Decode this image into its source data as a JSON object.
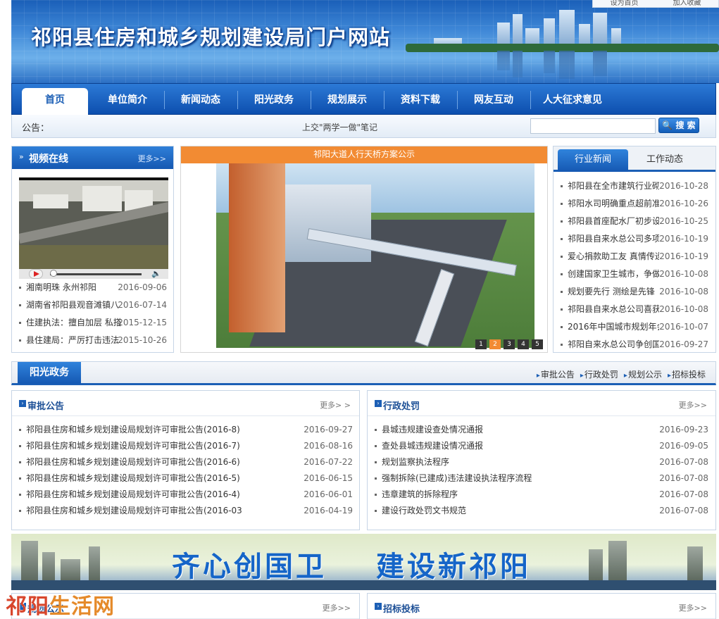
{
  "header": {
    "site_title": "祁阳县住房和城乡规划建设局门户网站",
    "top_links": [
      "设为首页",
      "加入收藏"
    ]
  },
  "nav": {
    "items": [
      {
        "label": "首页"
      },
      {
        "label": "单位简介"
      },
      {
        "label": "新闻动态"
      },
      {
        "label": "阳光政务"
      },
      {
        "label": "规划展示"
      },
      {
        "label": "资料下载"
      },
      {
        "label": "网友互动"
      },
      {
        "label": "人大征求意见"
      }
    ]
  },
  "notice": {
    "label": "公告：",
    "text": "上交\"两学一做\"笔记",
    "search_value": "",
    "search_button": "搜 索"
  },
  "video": {
    "title": "视频在线",
    "more": "更多>>",
    "items": [
      {
        "title": "湘南明珠 永州祁阳",
        "date": "2016-09-06"
      },
      {
        "title": "湖南省祁阳县观音滩镇八",
        "date": "2016-07-14"
      },
      {
        "title": "住建执法：擅自加层 私搭",
        "date": "2015-12-15"
      },
      {
        "title": "县住建局：严厉打击违法",
        "date": "2015-10-26"
      }
    ]
  },
  "slideshow": {
    "caption": "祁阳大道人行天桥方案公示",
    "pages": [
      "1",
      "2",
      "3",
      "4",
      "5"
    ],
    "active_page": 2
  },
  "news_tabs": {
    "tabs": [
      "行业新闻",
      "工作动态"
    ],
    "items": [
      {
        "title": "祁阳县在全市建筑行业砌",
        "date": "2016-10-28"
      },
      {
        "title": "祁阳水司明确重点超前准",
        "date": "2016-10-26"
      },
      {
        "title": "祁阳县首座配水厂初步设",
        "date": "2016-10-25"
      },
      {
        "title": "祁阳县自来水总公司多项",
        "date": "2016-10-19"
      },
      {
        "title": "爱心捐款助工友 真情传递",
        "date": "2016-10-19"
      },
      {
        "title": "创建国家卫生城市，争做",
        "date": "2016-10-08"
      },
      {
        "title": "规划要先行 测绘是先锋",
        "date": "2016-10-08"
      },
      {
        "title": "祁阳县自来水总公司喜获",
        "date": "2016-10-08"
      },
      {
        "title": "2016年中国城市规划年会",
        "date": "2016-10-07"
      },
      {
        "title": "祁阳自来水总公司争创国",
        "date": "2016-09-27"
      }
    ]
  },
  "sunshine": {
    "title": "阳光政务",
    "links": [
      "审批公告",
      "行政处罚",
      "规划公示",
      "招标投标"
    ]
  },
  "approval": {
    "title": "审批公告",
    "more": "更多> >",
    "items": [
      {
        "title": "祁阳县住房和城乡规划建设局规划许可审批公告(2016-8)",
        "date": "2016-09-27"
      },
      {
        "title": "祁阳县住房和城乡规划建设局规划许可审批公告(2016-7)",
        "date": "2016-08-16"
      },
      {
        "title": "祁阳县住房和城乡规划建设局规划许可审批公告(2016-6)",
        "date": "2016-07-22"
      },
      {
        "title": "祁阳县住房和城乡规划建设局规划许可审批公告(2016-5)",
        "date": "2016-06-15"
      },
      {
        "title": "祁阳县住房和城乡规划建设局规划许可审批公告(2016-4)",
        "date": "2016-06-01"
      },
      {
        "title": "祁阳县住房和城乡规划建设局规划许可审批公告(2016-03",
        "date": "2016-04-19"
      }
    ]
  },
  "penalty": {
    "title": "行政处罚",
    "more": "更多>>",
    "items": [
      {
        "title": "县城违规建设查处情况通报",
        "date": "2016-09-23"
      },
      {
        "title": "查处县城违规建设情况通报",
        "date": "2016-09-05"
      },
      {
        "title": "规划监察执法程序",
        "date": "2016-07-08"
      },
      {
        "title": "强制拆除(已建成)违法建设执法程序流程",
        "date": "2016-07-08"
      },
      {
        "title": "违章建筑的拆除程序",
        "date": "2016-07-08"
      },
      {
        "title": "建设行政处罚文书规范",
        "date": "2016-07-08"
      }
    ]
  },
  "banner": {
    "slogan1": "齐心创国卫",
    "slogan2": "建设新祁阳"
  },
  "bottom": {
    "left_title": "规划公示",
    "left_more": "更多>>",
    "right_title": "招标投标",
    "right_more": "更多>>"
  },
  "watermark": {
    "part1": "祁阳",
    "part2": "生活网"
  }
}
